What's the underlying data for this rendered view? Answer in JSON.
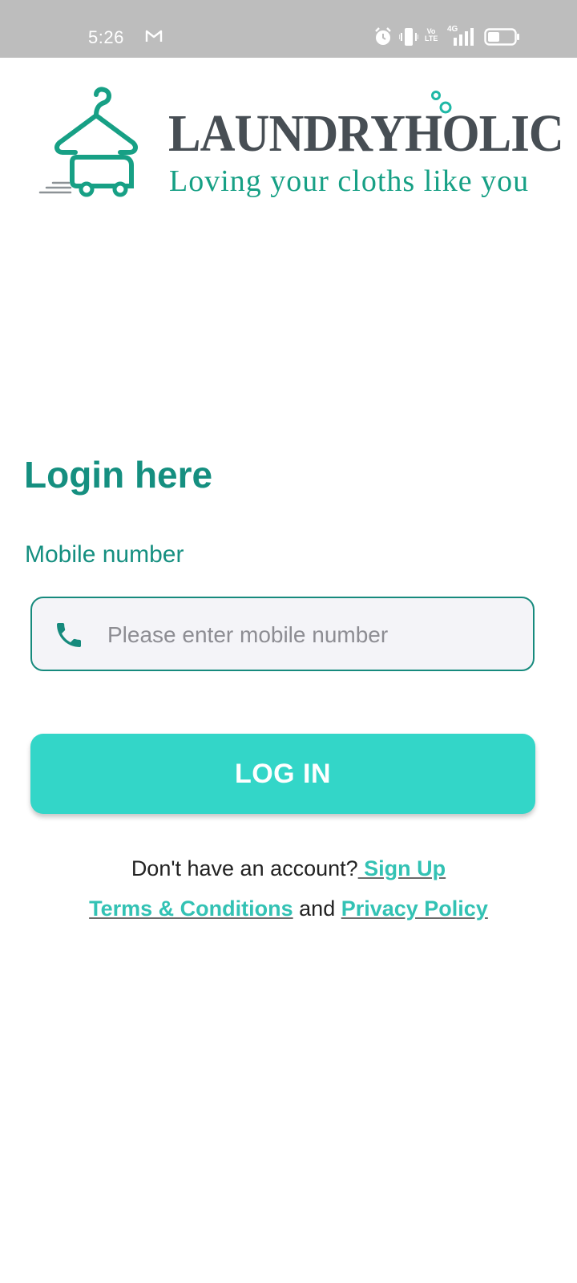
{
  "status_bar": {
    "time": "5:26",
    "mail_icon": "gmail-icon",
    "volte_label": "Vo LTE",
    "network_label": "4G",
    "icons": [
      "alarm-icon",
      "vibrate-icon",
      "volte-icon",
      "signal-icon",
      "battery-icon"
    ]
  },
  "logo": {
    "name": "LAUNDRYHOLIC",
    "tagline": "Loving your cloths like you",
    "icon": "hanger-van-icon"
  },
  "login": {
    "title": "Login here",
    "mobile_label": "Mobile number",
    "mobile_value": "",
    "mobile_placeholder": "Please enter mobile number",
    "button_label": "LOG IN",
    "no_account_text": "Don't have an account?",
    "signup_link": " Sign Up",
    "terms_link": "Terms & Conditions",
    "and_text": " and ",
    "privacy_link": "Privacy Policy"
  },
  "colors": {
    "primary": "#158f80",
    "button": "#33d6c8",
    "link": "#33c2b4",
    "status_bar": "#bdbdbd",
    "logo_text": "#474e54"
  }
}
